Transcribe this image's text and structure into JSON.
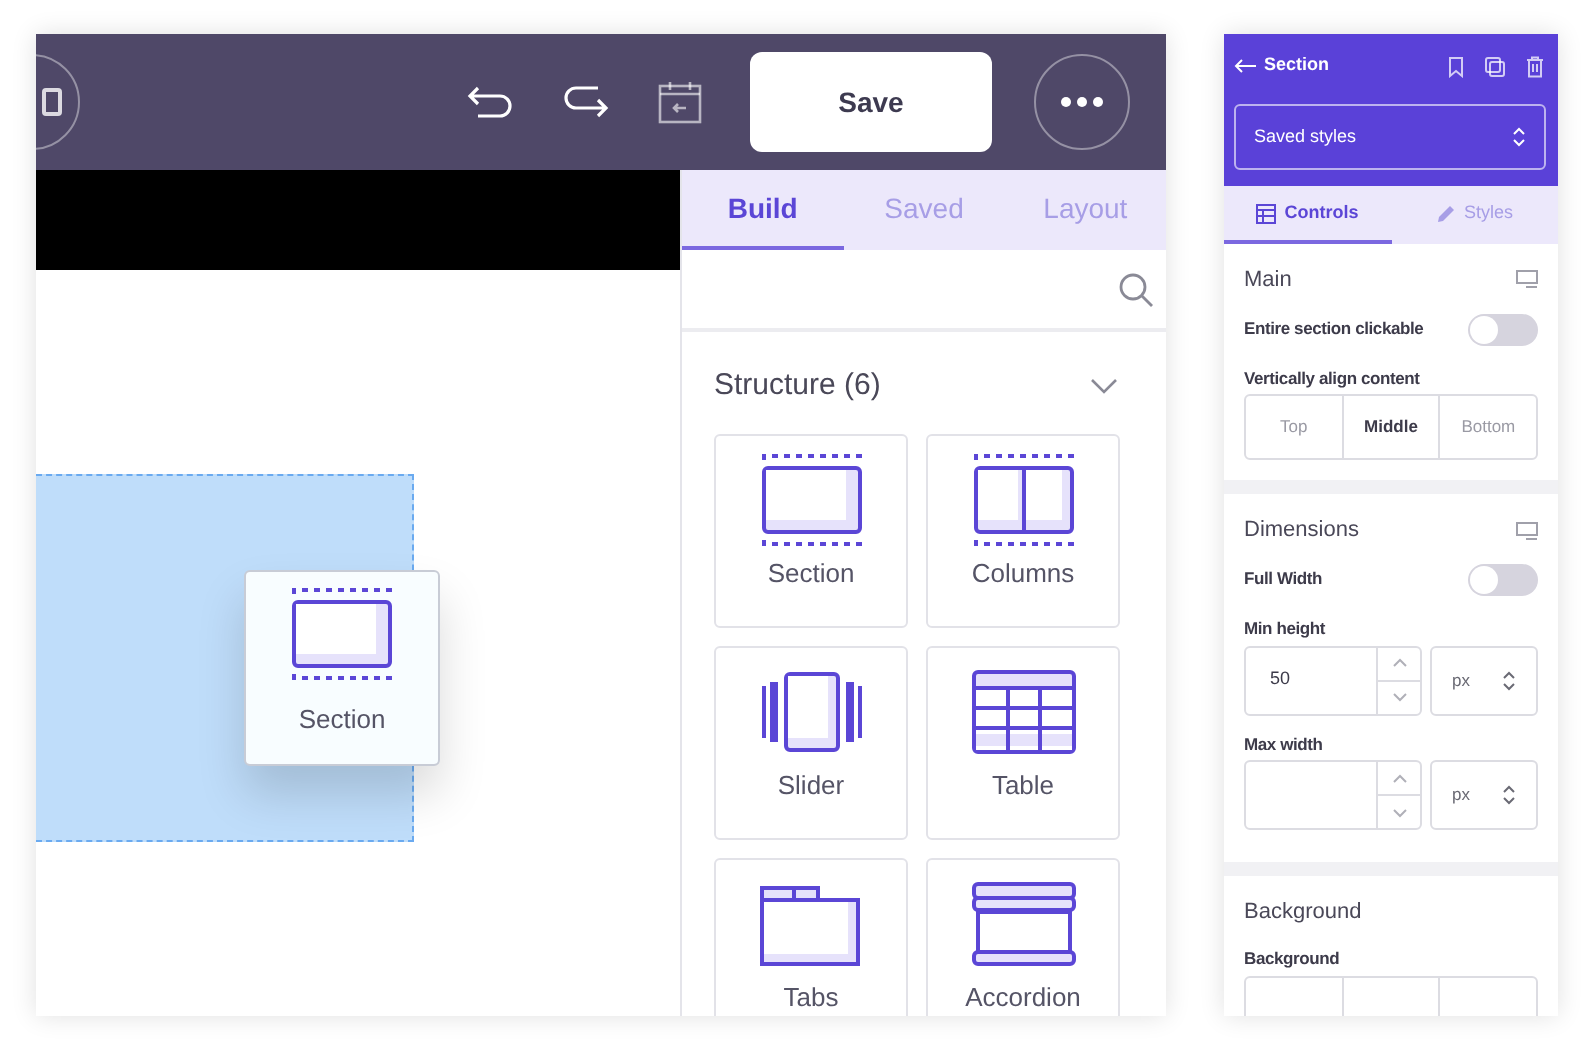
{
  "editor": {
    "save_label": "Save",
    "tabs": [
      {
        "label": "Build",
        "selected": true
      },
      {
        "label": "Saved",
        "selected": false
      },
      {
        "label": "Layout",
        "selected": false
      }
    ],
    "structure": {
      "title": "Structure (6)",
      "expanded": true,
      "items": [
        {
          "label": "Section",
          "kind": "section"
        },
        {
          "label": "Columns",
          "kind": "columns"
        },
        {
          "label": "Slider",
          "kind": "slider"
        },
        {
          "label": "Table",
          "kind": "table"
        },
        {
          "label": "Tabs",
          "kind": "tabs"
        },
        {
          "label": "Accordion",
          "kind": "accordion"
        }
      ]
    },
    "drag_preview": {
      "label": "Section",
      "kind": "section"
    }
  },
  "settings": {
    "title": "Section",
    "saved_styles": "Saved styles",
    "tabs": [
      {
        "label": "Controls",
        "selected": true
      },
      {
        "label": "Styles",
        "selected": false
      }
    ],
    "groups": [
      {
        "title": "Main",
        "rows": [
          {
            "kind": "toggle",
            "label": "Entire section clickable",
            "on": false
          },
          {
            "kind": "segmented",
            "label": "Vertically align content",
            "options": [
              {
                "label": "Top",
                "selected": false
              },
              {
                "label": "Middle",
                "selected": true
              },
              {
                "label": "Bottom",
                "selected": false
              }
            ]
          }
        ]
      },
      {
        "title": "Dimensions",
        "rows": [
          {
            "kind": "toggle",
            "label": "Full Width",
            "on": false
          },
          {
            "kind": "number",
            "label": "Min height",
            "value": "50",
            "unit": "px"
          },
          {
            "kind": "number",
            "label": "Max width",
            "unit": "px"
          }
        ]
      },
      {
        "title": "Background",
        "rows": [
          {
            "kind": "segmented",
            "label": "Background"
          }
        ]
      }
    ]
  }
}
